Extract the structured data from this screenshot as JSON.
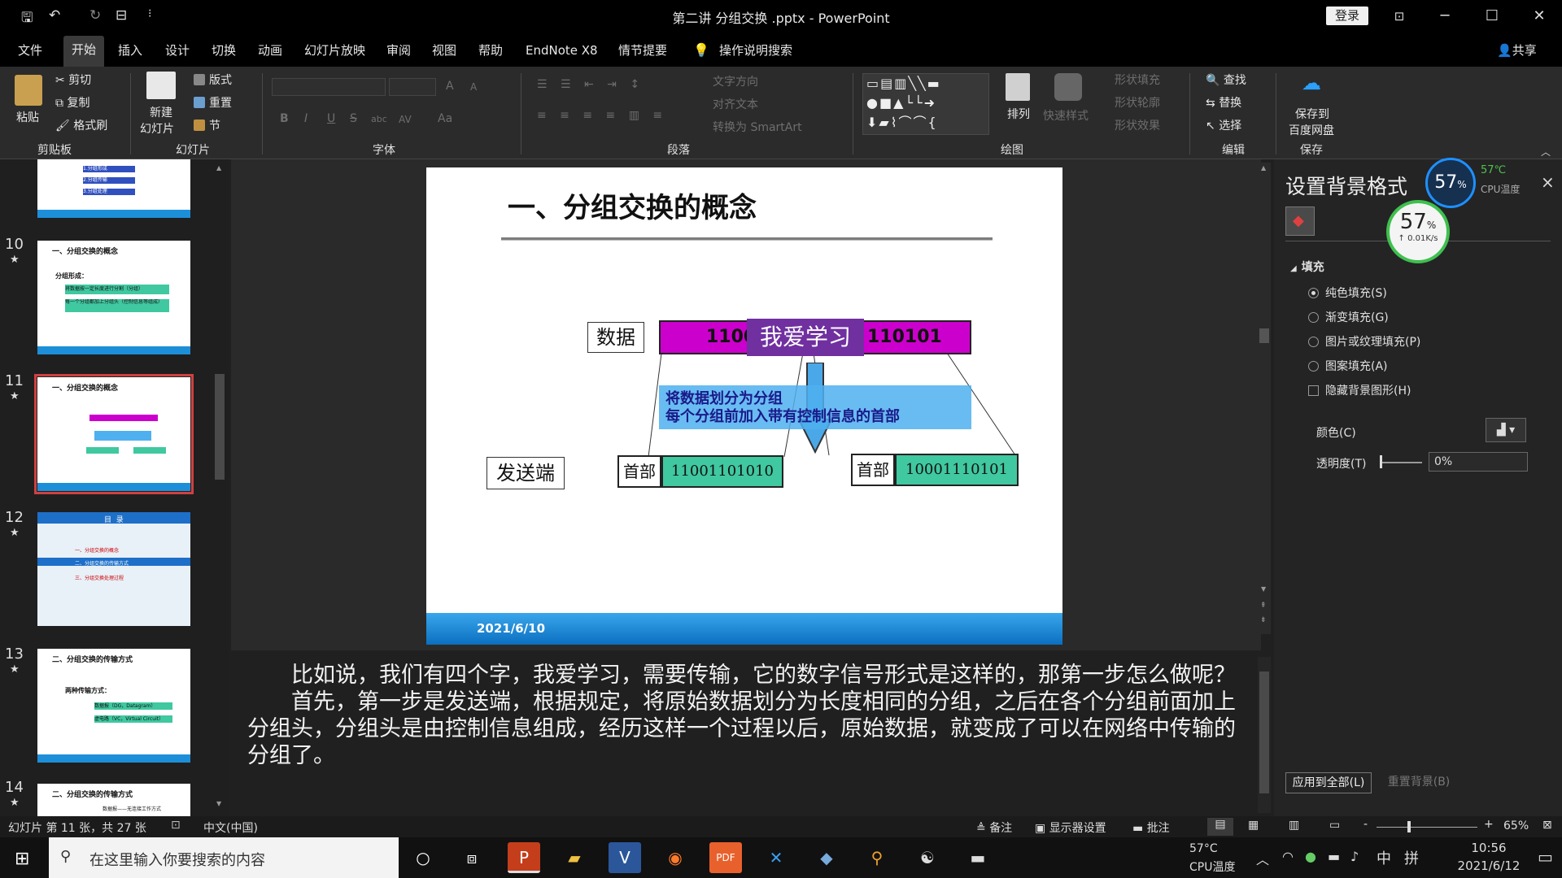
{
  "window": {
    "title": "第二讲 分组交换 .pptx - PowerPoint",
    "login": "登录",
    "min": "─",
    "max": "☐",
    "close": "✕",
    "icon_box": "⊡"
  },
  "quick_access": {
    "save": "🖫",
    "undo": "↶",
    "redo": "↻",
    "present": "⊟",
    "more": "⁝"
  },
  "menu": {
    "items": [
      "文件",
      "开始",
      "插入",
      "设计",
      "切换",
      "动画",
      "幻灯片放映",
      "审阅",
      "视图",
      "帮助",
      "EndNote X8",
      "情节提要"
    ],
    "search": "操作说明搜索",
    "share": "共享"
  },
  "ribbon": {
    "clipboard": {
      "paste": "粘贴",
      "cut": "剪切",
      "copy": "复制",
      "format_painter": "格式刷",
      "label": "剪贴板"
    },
    "slides": {
      "new_slide": "新建",
      "new_slide2": "幻灯片",
      "layout": "版式",
      "reset": "重置",
      "section": "节",
      "label": "幻灯片"
    },
    "font": {
      "label": "字体",
      "bold": "B",
      "italic": "I",
      "underline": "U",
      "strike": "S",
      "abc": "abc",
      "av": "AV",
      "aa": "Aa",
      "grow": "A",
      "shrink": "A"
    },
    "paragraph": {
      "label": "段落",
      "text_direction": "文字方向",
      "align_text": "对齐文本",
      "smartart": "转换为 SmartArt"
    },
    "drawing": {
      "label": "绘图",
      "arrange": "排列",
      "quick_styles": "快速样式",
      "shape_fill": "形状填充",
      "shape_outline": "形状轮廓",
      "shape_effects": "形状效果"
    },
    "editing": {
      "label": "编辑",
      "find": "查找",
      "replace": "替换",
      "select": "选择"
    },
    "save": {
      "label": "保存",
      "save_baidu": "保存到",
      "save_baidu2": "百度网盘"
    }
  },
  "thumbnails": [
    {
      "num": "10",
      "star": "★",
      "title": "一、分组交换的概念"
    },
    {
      "num": "11",
      "star": "★",
      "title": "一、分组交换的概念"
    },
    {
      "num": "12",
      "star": "★",
      "title": "目  录"
    },
    {
      "num": "13",
      "star": "★",
      "title": "二、分组交换的传输方式"
    },
    {
      "num": "14",
      "star": "★",
      "title": "二、分组交换的传输方式"
    }
  ],
  "thumb_details": {
    "t9_a": "1.分组形成",
    "t9_b": "2.分组传输",
    "t9_c": "3.分组处理",
    "t10_sub": "分组形成：",
    "t10_b1": "将数据按一定长度进行分割（分组）",
    "t10_b2": "每一个分组都加上分组头（控制信息等组成）",
    "t12_i1": "一、分组交换的概念",
    "t12_i2": "二、分组交换的传输方式",
    "t12_i3": "三、分组交换处理过程",
    "t13_sub": "两种传输方式：",
    "t13_b1": "数据报（DG，Datagram）",
    "t13_b2": "虚电路（VC，Virtual Circuit）",
    "t14_sub": "数据报——无连接工作方式"
  },
  "slide": {
    "title": "一、分组交换的概念",
    "data_label": "数据",
    "data_bits_left": "1100",
    "data_bits_right": "110101",
    "overlay": "我爱学习",
    "desc_line1": "将数据划分为分组",
    "desc_line2": "每个分组前加入带有控制信息的首部",
    "sender": "发送端",
    "header1": "首部",
    "packet1": "11001101010",
    "header2": "首部",
    "packet2": "10001110101",
    "date": "2021/6/10",
    "colors": {
      "magenta": "#cc00cc",
      "purple": "#7030a0",
      "blue": "#4fb0f0",
      "teal": "#40c8a0",
      "arrow": "#4aa8e8",
      "footer": "#0a7fd0"
    }
  },
  "notes": {
    "p1": "比如说，我们有四个字，我爱学习，需要传输，它的数字信号形式是这样的，那第一步怎么做呢？",
    "p2": "首先，第一步是发送端，根据规定，将原始数据划分为长度相同的分组，之后在各个分组前面加上分组头，分组头是由控制信息组成，经历这样一个过程以后，原始数据，就变成了可以在网络中传输的分组了。"
  },
  "pane": {
    "title": "设置背景格式",
    "close": "×",
    "section": "填充",
    "options": [
      "纯色填充(S)",
      "渐变填充(G)",
      "图片或纹理填充(P)",
      "图案填充(A)"
    ],
    "hide_bg": "隐藏背景图形(H)",
    "color_label": "颜色(C)",
    "transparency_label": "透明度(T)",
    "transparency_value": "0%",
    "apply_all": "应用到全部(L)",
    "reset_bg": "重置背景(B)"
  },
  "cpu_widget": {
    "pct": "57",
    "unit": "%",
    "temp": "57℃",
    "temp_label": "CPU温度",
    "speed": "↑ 0.01K/s"
  },
  "status": {
    "slide_info": "幻灯片 第 11 张，共 27 张",
    "lang": "中文(中国)",
    "notes": "备注",
    "display": "显示器设置",
    "comments": "批注",
    "zoom": "65%",
    "minus": "-",
    "plus": "+"
  },
  "taskbar": {
    "search_placeholder": "在这里输入你要搜索的内容",
    "temp": "57°C",
    "temp_label": "CPU温度",
    "ime1": "中",
    "ime2": "拼",
    "time": "10:56",
    "date": "2021/6/12"
  }
}
